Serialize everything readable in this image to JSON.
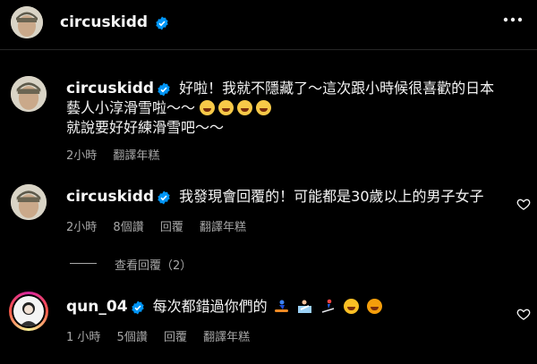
{
  "header": {
    "username": "circuskidd",
    "more_icon": "ellipsis-icon"
  },
  "caption": {
    "username": "circuskidd",
    "line1": "好啦！我就不隱藏了～這次跟小時候很喜歡的日本",
    "line2_text": "藝人小淳滑雪啦～～",
    "line2_emojis": [
      "grinning-squint-emoji",
      "grinning-squint-emoji",
      "grinning-squint-emoji",
      "grinning-squint-emoji"
    ],
    "line3": "就說要好好練滑雪吧～～",
    "time": "2小時",
    "translate": "翻譯年糕"
  },
  "comment1": {
    "username": "circuskidd",
    "text": "我發現會回覆的！可能都是30歲以上的男子女子",
    "time": "2小時",
    "likes": "8個讚",
    "reply": "回覆",
    "translate": "翻譯年糕",
    "view_replies": "查看回覆（2）"
  },
  "comment2": {
    "username": "qun_04",
    "text": "每次都錯過你們的",
    "emojis": [
      "snowboarder-emoji",
      "person-bouncing-emoji",
      "skier-emoji",
      "pleading-face-emoji",
      "crying-face-emoji"
    ],
    "time": "1 小時",
    "likes": "5個讚",
    "reply": "回覆",
    "translate": "翻譯年糕"
  },
  "colors": {
    "background": "#000000",
    "text": "#f5f5f5",
    "meta": "#a8a8a8",
    "verified": "#0095f6"
  }
}
